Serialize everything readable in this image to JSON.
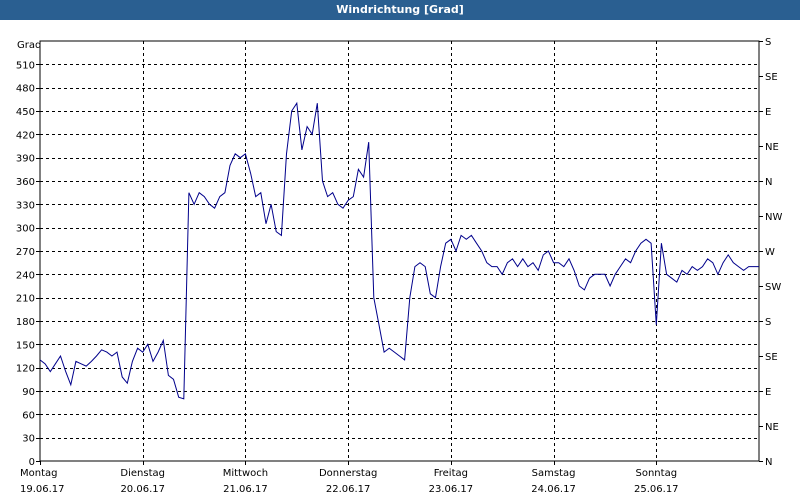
{
  "chart_data": {
    "type": "line",
    "title": "Windrichtung [Grad]",
    "ylabel": "Grad",
    "ylim": [
      0,
      540
    ],
    "yticks": [
      0,
      30,
      60,
      90,
      120,
      150,
      180,
      210,
      240,
      270,
      300,
      330,
      360,
      390,
      420,
      450,
      480,
      510
    ],
    "y2_ticks": [
      {
        "value": 0,
        "label": "N"
      },
      {
        "value": 45,
        "label": "NE"
      },
      {
        "value": 90,
        "label": "E"
      },
      {
        "value": 135,
        "label": "SE"
      },
      {
        "value": 180,
        "label": "S"
      },
      {
        "value": 225,
        "label": "SW"
      },
      {
        "value": 270,
        "label": "W"
      },
      {
        "value": 315,
        "label": "NW"
      },
      {
        "value": 360,
        "label": "N"
      },
      {
        "value": 405,
        "label": "NE"
      },
      {
        "value": 450,
        "label": "E"
      },
      {
        "value": 495,
        "label": "SE"
      },
      {
        "value": 540,
        "label": "S"
      }
    ],
    "xlim": [
      0,
      7
    ],
    "x_ticks": [
      {
        "x": 0,
        "day": "Montag",
        "date": "19.06.17"
      },
      {
        "x": 1,
        "day": "Dienstag",
        "date": "20.06.17"
      },
      {
        "x": 2,
        "day": "Mittwoch",
        "date": "21.06.17"
      },
      {
        "x": 3,
        "day": "Donnerstag",
        "date": "22.06.17"
      },
      {
        "x": 4,
        "day": "Freitag",
        "date": "23.06.17"
      },
      {
        "x": 5,
        "day": "Samstag",
        "date": "24.06.17"
      },
      {
        "x": 6,
        "day": "Sonntag",
        "date": "25.06.17"
      }
    ],
    "grid": true,
    "color": "#00008b",
    "series": [
      {
        "x": [
          0.0,
          0.05,
          0.1,
          0.15,
          0.2,
          0.25,
          0.3,
          0.35,
          0.4,
          0.45,
          0.5,
          0.55,
          0.6,
          0.65,
          0.7,
          0.75,
          0.8,
          0.85,
          0.9,
          0.95,
          1.0,
          1.05,
          1.1,
          1.15,
          1.2,
          1.25,
          1.3,
          1.35,
          1.4,
          1.45,
          1.5,
          1.55,
          1.6,
          1.65,
          1.7,
          1.75,
          1.8,
          1.85,
          1.9,
          1.95,
          2.0,
          2.05,
          2.1,
          2.15,
          2.2,
          2.25,
          2.3,
          2.35,
          2.4,
          2.45,
          2.5,
          2.55,
          2.6,
          2.65,
          2.7,
          2.75,
          2.8,
          2.85,
          2.9,
          2.95,
          3.0,
          3.05,
          3.1,
          3.15,
          3.2,
          3.25,
          3.3,
          3.35,
          3.4,
          3.45,
          3.5,
          3.55,
          3.6,
          3.65,
          3.7,
          3.75,
          3.8,
          3.85,
          3.9,
          3.95,
          4.0,
          4.05,
          4.1,
          4.15,
          4.2,
          4.25,
          4.3,
          4.35,
          4.4,
          4.45,
          4.5,
          4.55,
          4.6,
          4.65,
          4.7,
          4.75,
          4.8,
          4.85,
          4.9,
          4.95,
          5.0,
          5.05,
          5.1,
          5.15,
          5.2,
          5.25,
          5.3,
          5.35,
          5.4,
          5.45,
          5.5,
          5.55,
          5.6,
          5.65,
          5.7,
          5.75,
          5.8,
          5.85,
          5.9,
          5.95,
          6.0,
          6.05,
          6.1,
          6.15,
          6.2,
          6.25,
          6.3,
          6.35,
          6.4,
          6.45,
          6.5,
          6.55,
          6.6,
          6.65,
          6.7,
          6.75,
          6.8,
          6.85,
          6.9,
          6.95,
          7.0
        ],
        "values": [
          130,
          125,
          115,
          125,
          135,
          115,
          98,
          128,
          125,
          122,
          128,
          135,
          143,
          140,
          135,
          140,
          108,
          100,
          128,
          145,
          140,
          150,
          128,
          140,
          155,
          110,
          105,
          82,
          80,
          345,
          330,
          345,
          340,
          330,
          325,
          340,
          345,
          380,
          395,
          390,
          395,
          370,
          340,
          345,
          305,
          330,
          295,
          290,
          395,
          450,
          460,
          400,
          430,
          420,
          460,
          360,
          340,
          345,
          330,
          325,
          335,
          340,
          375,
          365,
          410,
          210,
          175,
          140,
          145,
          140,
          135,
          130,
          210,
          250,
          255,
          250,
          215,
          210,
          250,
          280,
          285,
          270,
          290,
          285,
          290,
          280,
          270,
          255,
          250,
          250,
          240,
          255,
          260,
          250,
          260,
          250,
          255,
          245,
          265,
          270,
          255,
          255,
          250,
          260,
          245,
          225,
          220,
          235,
          240,
          240,
          240,
          225,
          240,
          250,
          260,
          255,
          270,
          280,
          285,
          280,
          175,
          280,
          240,
          235,
          230,
          245,
          240,
          250,
          245,
          250,
          260,
          255,
          240,
          255,
          265,
          255,
          250,
          245,
          250,
          250,
          250
        ]
      }
    ]
  }
}
